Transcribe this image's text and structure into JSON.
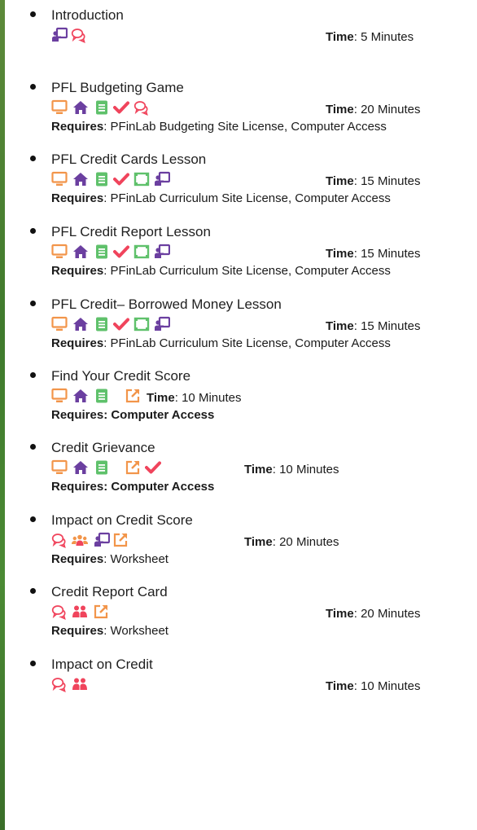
{
  "colors": {
    "orange": "#f2954a",
    "purple": "#6b3fa0",
    "green": "#5fc16b",
    "red": "#f0445c",
    "sidebar": "#4b8a34"
  },
  "labels": {
    "time": "Time",
    "requires": "Requires"
  },
  "items": [
    {
      "title": "Introduction",
      "icons": [
        "presentation-icon",
        "discussion-icon"
      ],
      "time": "5 Minutes",
      "requires": null
    },
    {
      "title": "PFL Budgeting Game",
      "icons": [
        "computer-icon",
        "home-icon",
        "document-icon",
        "check-icon",
        "discussion-icon"
      ],
      "time": "20 Minutes",
      "requires": "PFinLab Budgeting Site License, Computer Access"
    },
    {
      "title": "PFL Credit Cards Lesson",
      "icons": [
        "computer-icon",
        "home-icon",
        "document-icon",
        "check-icon",
        "video-icon",
        "presentation-icon"
      ],
      "time": "15 Minutes",
      "requires": "PFinLab Curriculum Site License, Computer Access"
    },
    {
      "title": "PFL Credit Report Lesson",
      "icons": [
        "computer-icon",
        "home-icon",
        "document-icon",
        "check-icon",
        "video-icon",
        "presentation-icon"
      ],
      "time": "15 Minutes",
      "requires": "PFinLab Curriculum Site License, Computer Access"
    },
    {
      "title": "PFL Credit– Borrowed Money Lesson",
      "icons": [
        "computer-icon",
        "home-icon",
        "document-icon",
        "check-icon",
        "video-icon",
        "presentation-icon"
      ],
      "time": "15 Minutes",
      "requires": "PFinLab Curriculum Site License, Computer Access"
    },
    {
      "title": "Find Your Credit Score",
      "icons": [
        "computer-icon",
        "home-icon",
        "document-icon",
        "external-link-icon"
      ],
      "time": "10 Minutes",
      "requires_bold": "Requires: Computer Access"
    },
    {
      "title": "Credit Grievance",
      "icons": [
        "computer-icon",
        "home-icon",
        "document-icon",
        "external-link-icon",
        "check-icon"
      ],
      "time": "10 Minutes",
      "requires_bold": "Requires: Computer Access"
    },
    {
      "title": "Impact on Credit Score",
      "icons": [
        "discussion-icon",
        "group-icon",
        "presentation-icon",
        "external-link-icon"
      ],
      "time": "20 Minutes",
      "requires": "Worksheet"
    },
    {
      "title": "Credit Report Card",
      "icons": [
        "discussion-icon",
        "pair-icon",
        "external-link-icon"
      ],
      "time": "20 Minutes",
      "requires": "Worksheet"
    },
    {
      "title": "Impact on Credit",
      "icons": [
        "discussion-icon",
        "pair-icon"
      ],
      "time": "10 Minutes",
      "requires": null
    }
  ]
}
